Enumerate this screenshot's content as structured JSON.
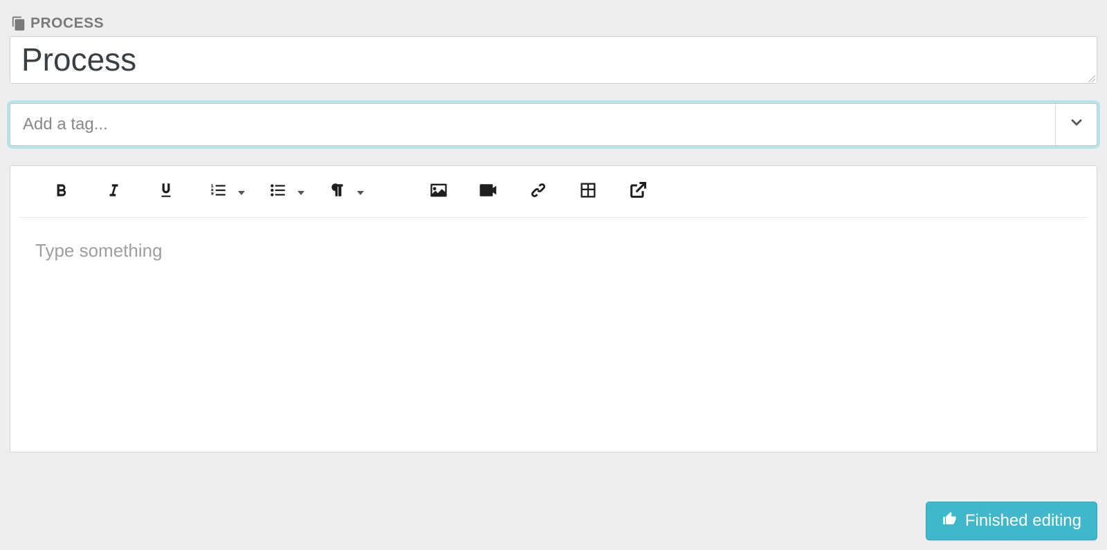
{
  "header": {
    "section_label": "PROCESS",
    "title_value": "Process"
  },
  "tags": {
    "placeholder": "Add a tag..."
  },
  "editor": {
    "placeholder": "Type something"
  },
  "actions": {
    "finish_label": "Finished editing"
  }
}
